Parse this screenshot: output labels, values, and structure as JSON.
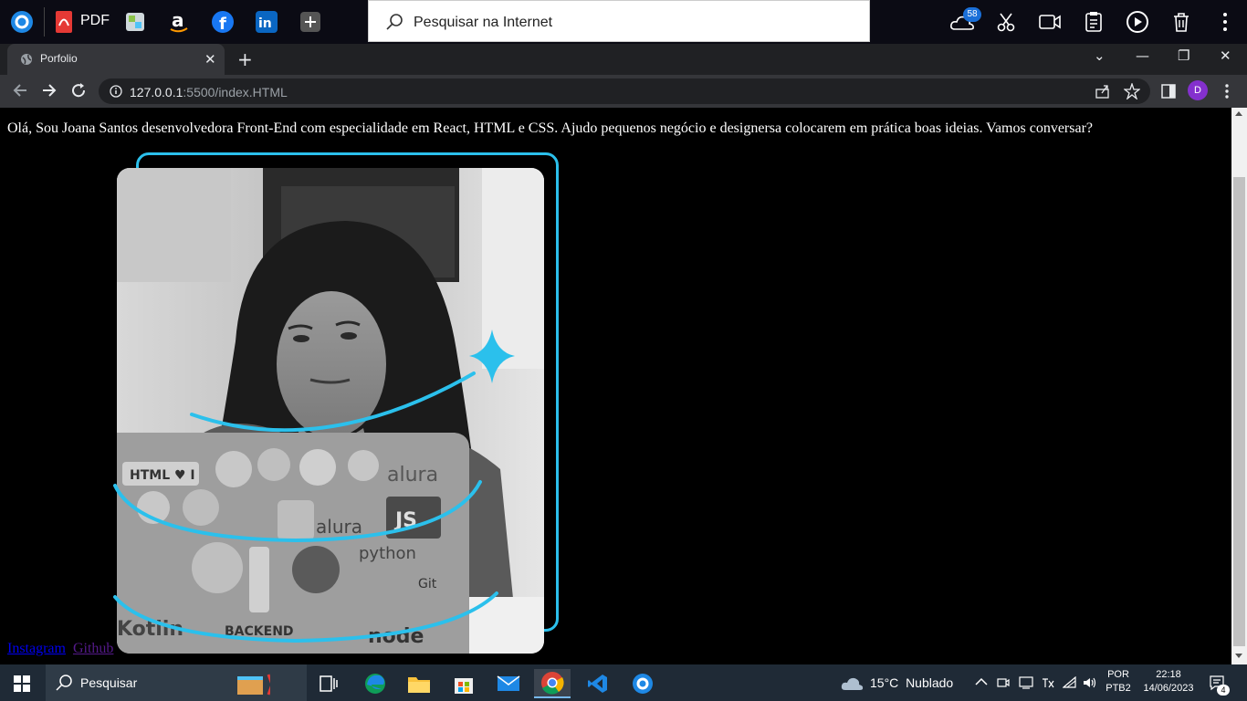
{
  "os_topbar": {
    "pdf_label": "PDF",
    "search_placeholder": "Pesquisar na Internet",
    "cloud_badge": "58"
  },
  "browser": {
    "tab_title": "Porfolio",
    "url_host": "127.0.0.1",
    "url_rest": ":5500/index.HTML",
    "profile_initial": "D"
  },
  "page": {
    "intro_text": "Olá, Sou Joana Santos desenvolvedora Front-End com especialidade em React, HTML e CSS. Ajudo pequenos negócio e designersa colocarem em prática boas ideias. Vamos conversar?",
    "links": [
      "Instagram",
      "Github"
    ],
    "accent_color": "#2bc0ec",
    "laptop_stickers": [
      "HTML ♥ I",
      "alura",
      "JS",
      "alura",
      "python",
      "Kotlin",
      "node",
      "BACKEND",
      "Git"
    ]
  },
  "taskbar": {
    "search_label": "Pesquisar",
    "weather_temp": "15°C",
    "weather_desc": "Nublado",
    "lang_top": "POR",
    "lang_bottom": "PTB2",
    "time": "22:18",
    "date": "14/06/2023",
    "notification_count": "4"
  }
}
